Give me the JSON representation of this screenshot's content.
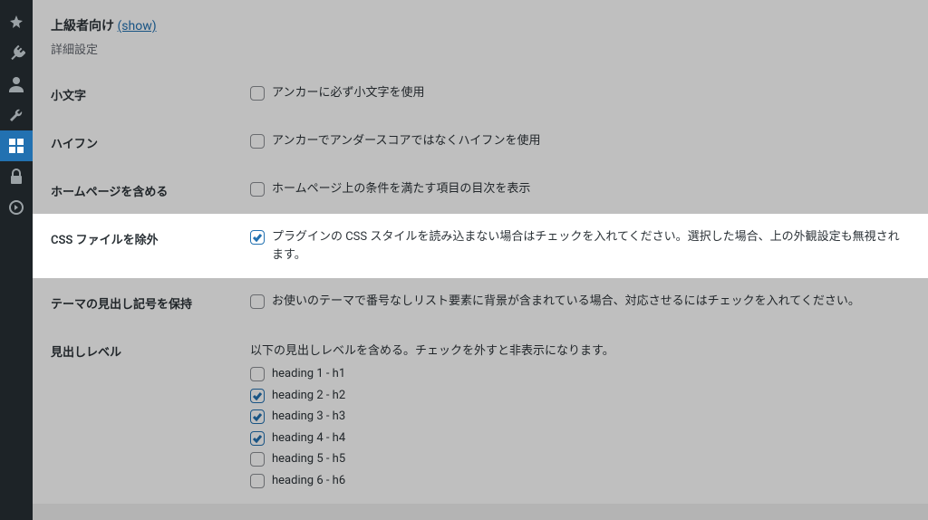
{
  "sidebar": {
    "items": [
      {
        "name": "pin-icon"
      },
      {
        "name": "plug-icon"
      },
      {
        "name": "user-icon"
      },
      {
        "name": "tools-icon"
      },
      {
        "name": "settings-icon",
        "active": true
      },
      {
        "name": "lock-icon"
      },
      {
        "name": "circle-icon"
      }
    ]
  },
  "section": {
    "title": "上級者向け",
    "show_link": "(show)",
    "subtitle": "詳細設定"
  },
  "rows": {
    "lowercase": {
      "label": "小文字",
      "cb_label": "アンカーに必ず小文字を使用",
      "checked": false
    },
    "hyphen": {
      "label": "ハイフン",
      "cb_label": "アンカーでアンダースコアではなくハイフンを使用",
      "checked": false
    },
    "homepage": {
      "label": "ホームページを含める",
      "cb_label": "ホームページ上の条件を満たす項目の目次を表示",
      "checked": false
    },
    "exclude_css": {
      "label": "CSS ファイルを除外",
      "cb_label": "プラグインの CSS スタイルを読み込まない場合はチェックを入れてください。選択した場合、上の外観設定も無視されます。",
      "checked": true
    },
    "preserve_bullets": {
      "label": "テーマの見出し記号を保持",
      "cb_label": "お使いのテーマで番号なしリスト要素に背景が含まれている場合、対応させるにはチェックを入れてください。",
      "checked": false
    },
    "heading_levels": {
      "label": "見出しレベル",
      "intro": "以下の見出しレベルを含める。チェックを外すと非表示になります。",
      "items": [
        {
          "label": "heading 1 - h1",
          "checked": false
        },
        {
          "label": "heading 2 - h2",
          "checked": true
        },
        {
          "label": "heading 3 - h3",
          "checked": true
        },
        {
          "label": "heading 4 - h4",
          "checked": true
        },
        {
          "label": "heading 5 - h5",
          "checked": false
        },
        {
          "label": "heading 6 - h6",
          "checked": false
        }
      ]
    }
  }
}
